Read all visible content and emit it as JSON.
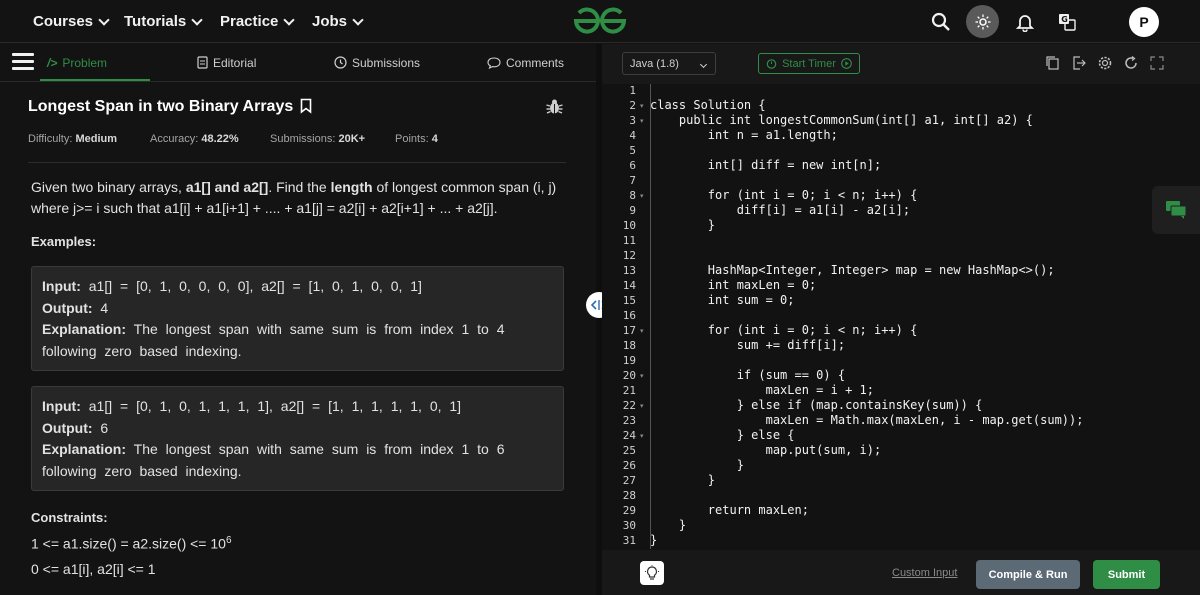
{
  "nav": {
    "courses": "Courses",
    "tutorials": "Tutorials",
    "practice": "Practice",
    "jobs": "Jobs",
    "avatar_initial": "P"
  },
  "tabs": {
    "problem": "Problem",
    "editorial": "Editorial",
    "submissions": "Submissions",
    "comments": "Comments"
  },
  "problem": {
    "title": "Longest Span in two Binary Arrays",
    "difficulty_label": "Difficulty:",
    "difficulty": "Medium",
    "accuracy_label": "Accuracy:",
    "accuracy": "48.22%",
    "submissions_label": "Submissions:",
    "submissions": "20K+",
    "points_label": "Points:",
    "points": "4",
    "desc_1": "Given two binary arrays, ",
    "desc_arrays": "a1[] and a2[]",
    "desc_2": ". Find the ",
    "desc_length": "length",
    "desc_3": " of longest common span (i, j) where j>= i such that a1[i] + a1[i+1] + .... + a1[j] =  a2[i] + a2[i+1] + ... + a2[j].",
    "examples_heading": "Examples:",
    "examples": [
      {
        "input_label": "Input:",
        "input": "a1[] = [0, 1, 0, 0, 0, 0], a2[] = [1, 0, 1, 0, 0, 1]",
        "output_label": "Output:",
        "output": "4",
        "explanation_label": "Explanation:",
        "explanation": "The longest span with same sum is from index 1 to 4 following zero based indexing."
      },
      {
        "input_label": "Input:",
        "input": "a1[] = [0, 1, 0, 1, 1, 1, 1], a2[] = [1, 1, 1, 1, 1, 0, 1]",
        "output_label": "Output:",
        "output": "6",
        "explanation_label": "Explanation:",
        "explanation": "The longest span with same sum is from index 1 to 6 following zero based indexing."
      }
    ],
    "constraints_heading": "Constraints:",
    "constraint_1": "1 <= a1.size() = a2.size() <= 10",
    "constraint_1_exp": "6",
    "constraint_2": "0 <= a1[i], a2[i] <= 1"
  },
  "editor": {
    "language": "Java (1.8)",
    "timer_label": "Start Timer",
    "code_lines": [
      "",
      "class Solution {",
      "    public int longestCommonSum(int[] a1, int[] a2) {",
      "        int n = a1.length;",
      "",
      "        int[] diff = new int[n];",
      "",
      "        for (int i = 0; i < n; i++) {",
      "            diff[i] = a1[i] - a2[i];",
      "        }",
      "",
      "",
      "        HashMap<Integer, Integer> map = new HashMap<>();",
      "        int maxLen = 0;",
      "        int sum = 0;",
      "",
      "        for (int i = 0; i < n; i++) {",
      "            sum += diff[i];",
      "",
      "            if (sum == 0) {",
      "                maxLen = i + 1;",
      "            } else if (map.containsKey(sum)) {",
      "                maxLen = Math.max(maxLen, i - map.get(sum));",
      "            } else {",
      "                map.put(sum, i);",
      "            }",
      "        }",
      "",
      "        return maxLen;",
      "    }",
      "}"
    ],
    "fold_lines": [
      2,
      3,
      8,
      17,
      20,
      22,
      24
    ]
  },
  "footer": {
    "custom_input": "Custom Input",
    "compile_run": "Compile & Run",
    "submit": "Submit"
  },
  "colors": {
    "accent": "#2f8d46",
    "background": "#131313"
  }
}
